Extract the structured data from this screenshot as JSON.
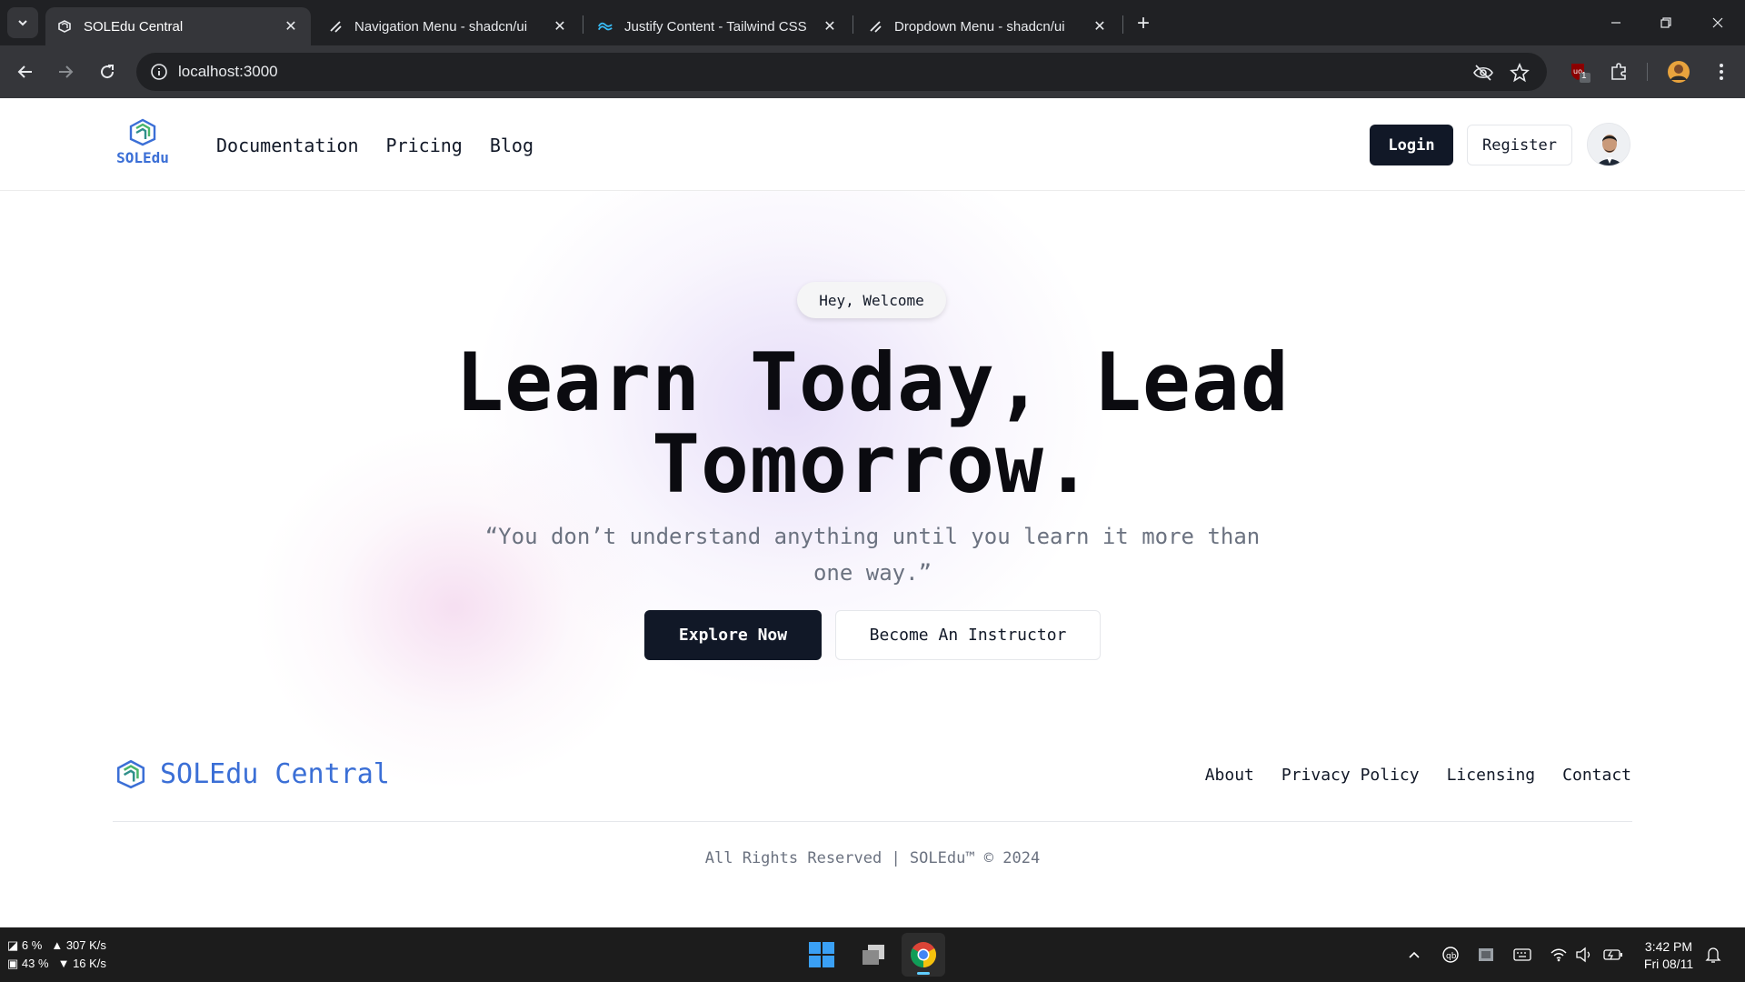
{
  "browser": {
    "tabs": [
      {
        "title": "SOLEdu Central",
        "favicon": "soledu-logo-icon",
        "active": true
      },
      {
        "title": "Navigation Menu - shadcn/ui",
        "favicon": "shadcn-icon",
        "active": false
      },
      {
        "title": "Justify Content - Tailwind CSS",
        "favicon": "tailwind-icon",
        "active": false
      },
      {
        "title": "Dropdown Menu - shadcn/ui",
        "favicon": "shadcn-icon",
        "active": false
      }
    ],
    "url": "localhost:3000",
    "extension_badge": "1"
  },
  "site": {
    "brand": "SOLEdu",
    "nav": [
      "Documentation",
      "Pricing",
      "Blog"
    ],
    "login_label": "Login",
    "register_label": "Register",
    "hero": {
      "pill": "Hey, Welcome",
      "title_line1": "Learn Today, Lead",
      "title_line2": "Tomorrow.",
      "quote": "“You don’t understand anything until you learn it more than one way.”",
      "primary_cta": "Explore Now",
      "secondary_cta": "Become An Instructor"
    },
    "footer": {
      "brand": "SOLEdu Central",
      "links": [
        "About",
        "Privacy Policy",
        "Licensing",
        "Contact"
      ],
      "copyright": "All Rights Reserved | SOLEdu™ © 2024"
    },
    "colors": {
      "brand_blue": "#3b6fd6",
      "dark": "#111827",
      "muted": "#6b7280"
    }
  },
  "taskbar": {
    "cpu": "6 %",
    "memory": "43 %",
    "upload": "307 K/s",
    "download": "16 K/s",
    "time": "3:42 PM",
    "date": "Fri 08/11"
  }
}
